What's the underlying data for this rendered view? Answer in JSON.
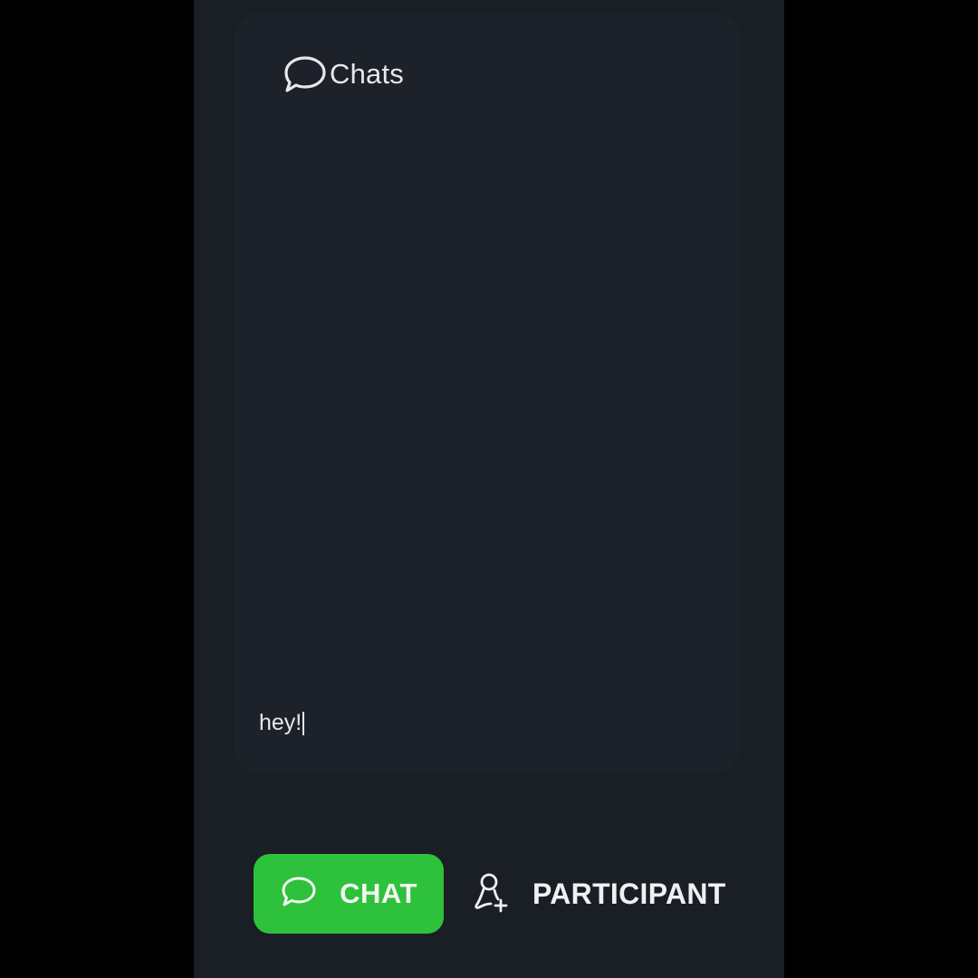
{
  "header": {
    "title": "Chats",
    "icon": "chat-bubble-icon"
  },
  "composer": {
    "value": "hey!"
  },
  "bottom_nav": {
    "items": [
      {
        "label": "CHAT",
        "icon": "chat-bubble-icon",
        "active": true
      },
      {
        "label": "PARTICIPANT",
        "icon": "add-person-icon",
        "active": false
      }
    ]
  },
  "colors": {
    "background": "#000000",
    "screen": "#1a1e25",
    "panel": "#1c212a",
    "accent": "#2ec13b",
    "text": "#e6e8ea"
  }
}
